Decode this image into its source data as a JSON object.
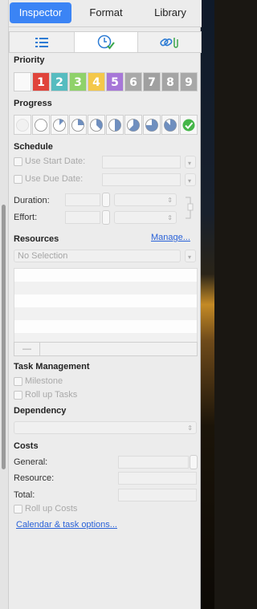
{
  "tabs": [
    "Inspector",
    "Format",
    "Library"
  ],
  "icon_tabs": [
    "list-icon",
    "clock-check-icon",
    "link-attachment-icon"
  ],
  "priority": {
    "title": "Priority",
    "levels": [
      "1",
      "2",
      "3",
      "4",
      "5",
      "6",
      "7",
      "8",
      "9"
    ],
    "colors": [
      "#e0443b",
      "#56bcc0",
      "#8fd26a",
      "#f4c84a",
      "#a777d8",
      "#a9a9a9",
      "#a0a0a0",
      "#a4a4a4",
      "#a8a8a8"
    ]
  },
  "progress": {
    "title": "Progress",
    "steps": [
      0,
      0,
      0.125,
      0.25,
      0.375,
      0.5,
      0.625,
      0.75,
      0.875,
      1
    ]
  },
  "schedule": {
    "title": "Schedule",
    "use_start_label": "Use Start Date:",
    "use_due_label": "Use Due Date:",
    "duration_label": "Duration:",
    "effort_label": "Effort:"
  },
  "resources": {
    "title": "Resources",
    "manage_link": "Manage...",
    "selection": "No Selection",
    "minus_label": "—"
  },
  "task_management": {
    "title": "Task Management",
    "milestone_label": "Milestone",
    "rollup_tasks_label": "Roll up Tasks"
  },
  "dependency": {
    "title": "Dependency"
  },
  "costs": {
    "title": "Costs",
    "general_label": "General:",
    "resource_label": "Resource:",
    "total_label": "Total:",
    "rollup_costs_label": "Roll up Costs"
  },
  "footer_link": "Calendar & task options..."
}
